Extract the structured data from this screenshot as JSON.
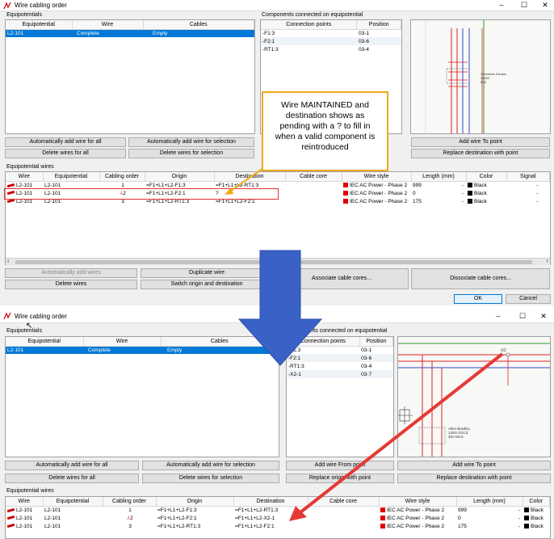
{
  "top": {
    "title": "Wire cabling order",
    "equipotentials_group": "Equipotentials",
    "equip_headers": [
      "Equipotential",
      "Wire",
      "Cables"
    ],
    "equip_row": [
      "L2-101",
      "Complete",
      "Empty"
    ],
    "components_group": "Components connected on equipotential",
    "comp_headers": [
      "Connection points",
      "Position"
    ],
    "comp_rows": [
      [
        "-F1:3",
        "03-1"
      ],
      [
        "-F2:1",
        "03-6"
      ],
      [
        "-RT1:3",
        "03-4"
      ]
    ],
    "buttons": {
      "auto_add_all": "Automatically add wire for all",
      "auto_add_sel": "Automatically add wire for selection",
      "delete_all": "Delete wires for all",
      "delete_sel": "Delete wires for selection",
      "add_to_point": "Add wire To point",
      "replace_dest": "Replace destination with point",
      "auto_add_wires": "Automatically add wires",
      "duplicate": "Duplicate wire",
      "delete_wires": "Delete wires",
      "switch": "Switch origin and destination",
      "associate": "Associate cable cores...",
      "dissociate": "Dissociate cable cores...",
      "ok": "OK",
      "cancel": "Cancel"
    },
    "wires_group": "Equipotential wires",
    "wire_headers": [
      "Wire",
      "Equipotential",
      "Cabling order",
      "Origin",
      "Destination",
      "Cable core",
      "Wire style",
      "Length (mm)",
      "Color",
      "Signal"
    ],
    "wire_rows": [
      [
        "L2-101",
        "L2-101",
        "1",
        "=F1+L1+L2-F1:3",
        "=F1+L1+L2-RT1:3",
        "",
        "IEC AC Power - Phase 2",
        "999",
        "-",
        "Black",
        "-"
      ],
      [
        "L2-101",
        "L2-101",
        "2",
        "=F1+L1+L2-F2:1",
        "?",
        "",
        "IEC AC Power - Phase 2",
        "0",
        "-",
        "Black",
        "-"
      ],
      [
        "L2-101",
        "L2-101",
        "3",
        "=F1+L1+L2-RT1:3",
        "=F1+L1+L2-F2:1",
        "",
        "IEC AC Power - Phase 2",
        "175",
        "-",
        "Black",
        "-"
      ]
    ],
    "schematic_label": "Schneider Electric\n49062\n50A"
  },
  "callout": "Wire MAINTAINED and destination shows as pending with a ? to fill in when a valid component is reintroduced",
  "bottom": {
    "title": "Wire cabling order",
    "equipotentials_group": "Equipotentials",
    "equip_headers": [
      "Equipotential",
      "Wire",
      "Cables"
    ],
    "equip_row": [
      "L2-101",
      "Complete",
      "Empty"
    ],
    "components_group": "Components connected on equipotential",
    "comp_headers": [
      "Connection points",
      "Position"
    ],
    "comp_rows": [
      [
        "-F1:3",
        "03-1"
      ],
      [
        "-F2:1",
        "03-6"
      ],
      [
        "-RT1:3",
        "03-4"
      ],
      [
        "-X2-1",
        "03-7"
      ]
    ],
    "buttons": {
      "auto_add_all": "Automatically add wire for all",
      "auto_add_sel": "Automatically add wire for selection",
      "delete_all": "Delete wires for all",
      "delete_sel": "Delete wires for selection",
      "add_from_point": "Add wire From point",
      "replace_origin": "Replace origin with point",
      "add_to_point": "Add wire To point",
      "replace_dest": "Replace destination with point"
    },
    "wires_group": "Equipotential wires",
    "wire_headers": [
      "Wire",
      "Equipotential",
      "Cabling order",
      "Origin",
      "Destination",
      "Cable core",
      "Wire style",
      "Length (mm)",
      "Color"
    ],
    "wire_rows": [
      [
        "L2-101",
        "L2-101",
        "1",
        "=F1+L1+L2-F1:3",
        "=F1+L1+L2-RT1:3",
        "",
        "IEC AC Power - Phase 2",
        "999",
        "-",
        "Black"
      ],
      [
        "L2-101",
        "L2-101",
        "2",
        "=F1+L1+L2-F2:1",
        "=F1+L1+L2-X2-1",
        "",
        "IEC AC Power - Phase 2",
        "0",
        "-",
        "Black"
      ],
      [
        "L2-101",
        "L2-101",
        "3",
        "=F1+L1+L2-RT1:3",
        "=F1+L1+L2-F2:1",
        "",
        "IEC AC Power - Phase 2",
        "175",
        "-",
        "Black"
      ]
    ],
    "schematic_label_top": "-X2",
    "schematic_label": "Allen-Bradley\n140G-G2C3\n30A MAX"
  },
  "colors": {
    "selection": "#0078d7",
    "callout_border": "#f0a818",
    "arrow_red": "#e53935",
    "arrow_blue": "#3a62c6",
    "wire_style_swatch": "#e00000"
  }
}
